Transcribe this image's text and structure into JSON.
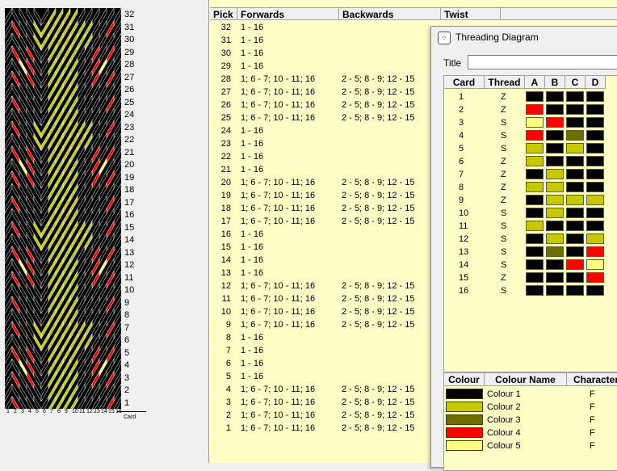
{
  "pattern": {
    "row_labels": [
      "32",
      "31",
      "30",
      "29",
      "28",
      "27",
      "26",
      "25",
      "24",
      "23",
      "22",
      "21",
      "20",
      "19",
      "18",
      "17",
      "16",
      "15",
      "14",
      "13",
      "12",
      "11",
      "10",
      "9",
      "8",
      "7",
      "6",
      "5",
      "4",
      "3",
      "2",
      "1"
    ],
    "card_labels": [
      "1",
      "2",
      "3",
      "4",
      "5",
      "6",
      "7",
      "8",
      "9",
      "10",
      "11",
      "12",
      "13",
      "14",
      "15",
      "16"
    ],
    "card_axis_label": "Card",
    "colors": {
      "c1": "#000000",
      "c2": "#c8c800",
      "c3": "#6e6e00",
      "c4": "#ff0000",
      "c5": "#ffff80"
    }
  },
  "table": {
    "headers": {
      "pick": "Pick",
      "forwards": "Forwards",
      "backwards": "Backwards",
      "twist": "Twist"
    },
    "rows": [
      {
        "pick": "32",
        "fw": "1 - 16",
        "bw": ""
      },
      {
        "pick": "31",
        "fw": "1 - 16",
        "bw": ""
      },
      {
        "pick": "30",
        "fw": "1 - 16",
        "bw": ""
      },
      {
        "pick": "29",
        "fw": "1 - 16",
        "bw": ""
      },
      {
        "pick": "28",
        "fw": "1; 6 - 7; 10 - 11; 16",
        "bw": "2 - 5; 8 - 9; 12 - 15"
      },
      {
        "pick": "27",
        "fw": "1; 6 - 7; 10 - 11; 16",
        "bw": "2 - 5; 8 - 9; 12 - 15"
      },
      {
        "pick": "26",
        "fw": "1; 6 - 7; 10 - 11; 16",
        "bw": "2 - 5; 8 - 9; 12 - 15"
      },
      {
        "pick": "25",
        "fw": "1; 6 - 7; 10 - 11; 16",
        "bw": "2 - 5; 8 - 9; 12 - 15"
      },
      {
        "pick": "24",
        "fw": "1 - 16",
        "bw": ""
      },
      {
        "pick": "23",
        "fw": "1 - 16",
        "bw": ""
      },
      {
        "pick": "22",
        "fw": "1 - 16",
        "bw": ""
      },
      {
        "pick": "21",
        "fw": "1 - 16",
        "bw": ""
      },
      {
        "pick": "20",
        "fw": "1; 6 - 7; 10 - 11; 16",
        "bw": "2 - 5; 8 - 9; 12 - 15"
      },
      {
        "pick": "19",
        "fw": "1; 6 - 7; 10 - 11; 16",
        "bw": "2 - 5; 8 - 9; 12 - 15"
      },
      {
        "pick": "18",
        "fw": "1; 6 - 7; 10 - 11; 16",
        "bw": "2 - 5; 8 - 9; 12 - 15"
      },
      {
        "pick": "17",
        "fw": "1; 6 - 7; 10 - 11; 16",
        "bw": "2 - 5; 8 - 9; 12 - 15"
      },
      {
        "pick": "16",
        "fw": "1 - 16",
        "bw": ""
      },
      {
        "pick": "15",
        "fw": "1 - 16",
        "bw": ""
      },
      {
        "pick": "14",
        "fw": "1 - 16",
        "bw": ""
      },
      {
        "pick": "13",
        "fw": "1 - 16",
        "bw": ""
      },
      {
        "pick": "12",
        "fw": "1; 6 - 7; 10 - 11; 16",
        "bw": "2 - 5; 8 - 9; 12 - 15"
      },
      {
        "pick": "11",
        "fw": "1; 6 - 7; 10 - 11; 16",
        "bw": "2 - 5; 8 - 9; 12 - 15"
      },
      {
        "pick": "10",
        "fw": "1; 6 - 7; 10 - 11; 16",
        "bw": "2 - 5; 8 - 9; 12 - 15"
      },
      {
        "pick": "9",
        "fw": "1; 6 - 7; 10 - 11; 16",
        "bw": "2 - 5; 8 - 9; 12 - 15"
      },
      {
        "pick": "8",
        "fw": "1 - 16",
        "bw": ""
      },
      {
        "pick": "7",
        "fw": "1 - 16",
        "bw": ""
      },
      {
        "pick": "6",
        "fw": "1 - 16",
        "bw": ""
      },
      {
        "pick": "5",
        "fw": "1 - 16",
        "bw": ""
      },
      {
        "pick": "4",
        "fw": "1; 6 - 7; 10 - 11; 16",
        "bw": "2 - 5; 8 - 9; 12 - 15"
      },
      {
        "pick": "3",
        "fw": "1; 6 - 7; 10 - 11; 16",
        "bw": "2 - 5; 8 - 9; 12 - 15"
      },
      {
        "pick": "2",
        "fw": "1; 6 - 7; 10 - 11; 16",
        "bw": "2 - 5; 8 - 9; 12 - 15"
      },
      {
        "pick": "1",
        "fw": "1; 6 - 7; 10 - 11; 16",
        "bw": "2 - 5; 8 - 9; 12 - 15"
      }
    ]
  },
  "threading": {
    "window_title": "Threading Diagram",
    "title_label": "Title",
    "title_value": "",
    "headers": {
      "card": "Card",
      "thread": "Thread",
      "a": "A",
      "b": "B",
      "c": "C",
      "d": "D"
    },
    "cards": [
      {
        "card": "1",
        "thread": "Z",
        "holes": [
          "c1",
          "c1",
          "c1",
          "c1"
        ]
      },
      {
        "card": "2",
        "thread": "Z",
        "holes": [
          "c4",
          "c1",
          "c1",
          "c1"
        ]
      },
      {
        "card": "3",
        "thread": "S",
        "holes": [
          "c5",
          "c4",
          "c1",
          "c1"
        ]
      },
      {
        "card": "4",
        "thread": "S",
        "holes": [
          "c4",
          "c1",
          "c3",
          "c1"
        ]
      },
      {
        "card": "5",
        "thread": "S",
        "holes": [
          "c2",
          "c1",
          "c2",
          "c1"
        ]
      },
      {
        "card": "6",
        "thread": "Z",
        "holes": [
          "c2",
          "c1",
          "c1",
          "c1"
        ]
      },
      {
        "card": "7",
        "thread": "Z",
        "holes": [
          "c1",
          "c2",
          "c1",
          "c1"
        ]
      },
      {
        "card": "8",
        "thread": "Z",
        "holes": [
          "c2",
          "c2",
          "c1",
          "c1"
        ]
      },
      {
        "card": "9",
        "thread": "Z",
        "holes": [
          "c1",
          "c2",
          "c2",
          "c2"
        ]
      },
      {
        "card": "10",
        "thread": "S",
        "holes": [
          "c1",
          "c2",
          "c1",
          "c1"
        ]
      },
      {
        "card": "11",
        "thread": "S",
        "holes": [
          "c2",
          "c1",
          "c1",
          "c1"
        ]
      },
      {
        "card": "12",
        "thread": "S",
        "holes": [
          "c1",
          "c2",
          "c1",
          "c2"
        ]
      },
      {
        "card": "13",
        "thread": "S",
        "holes": [
          "c1",
          "c3",
          "c1",
          "c4"
        ]
      },
      {
        "card": "14",
        "thread": "S",
        "holes": [
          "c1",
          "c1",
          "c4",
          "c5"
        ]
      },
      {
        "card": "15",
        "thread": "Z",
        "holes": [
          "c1",
          "c1",
          "c1",
          "c4"
        ]
      },
      {
        "card": "16",
        "thread": "S",
        "holes": [
          "c1",
          "c1",
          "c1",
          "c1"
        ]
      }
    ],
    "colour_headers": {
      "colour": "Colour",
      "name": "Colour Name",
      "character": "Character"
    },
    "colours": [
      {
        "key": "c1",
        "name": "Colour 1",
        "character": "F",
        "hex": "#000000"
      },
      {
        "key": "c2",
        "name": "Colour 2",
        "character": "F",
        "hex": "#c8c800"
      },
      {
        "key": "c3",
        "name": "Colour 3",
        "character": "F",
        "hex": "#6e6e00"
      },
      {
        "key": "c4",
        "name": "Colour 4",
        "character": "F",
        "hex": "#ff0000"
      },
      {
        "key": "c5",
        "name": "Colour 5",
        "character": "F",
        "hex": "#ffff80"
      }
    ]
  }
}
